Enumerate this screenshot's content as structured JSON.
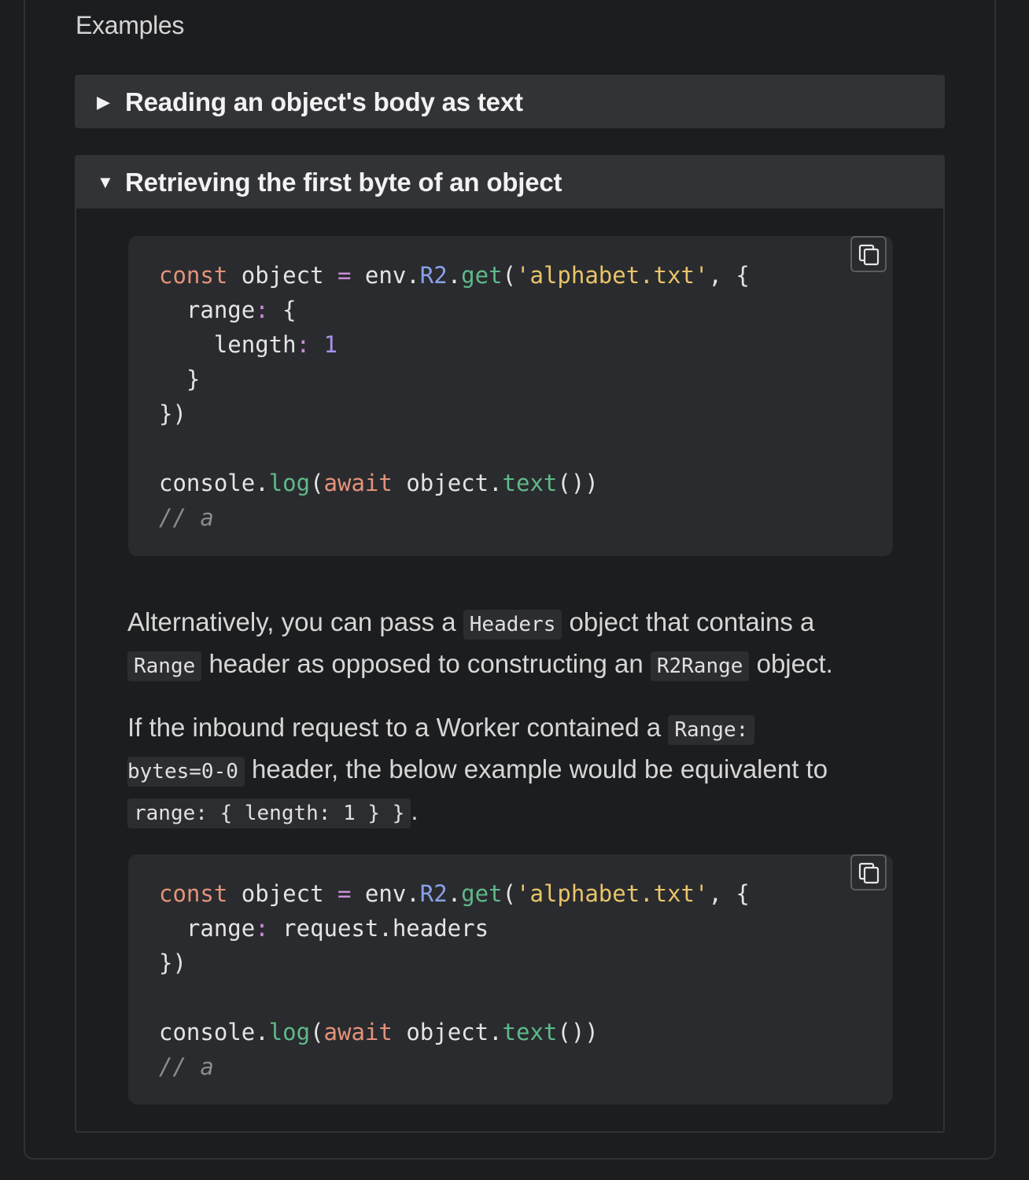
{
  "section": {
    "title": "Examples"
  },
  "example1": {
    "arrow": "▶",
    "title": "Reading an object's body as text"
  },
  "example2": {
    "arrow": "▼",
    "title": "Retrieving the first byte of an object"
  },
  "code1": {
    "tokens": {
      "const": "const",
      "object_decl": " object ",
      "eq": "=",
      "env": " env.",
      "r2": "R2",
      "dot": ".",
      "get": "get",
      "paren_open": "(",
      "filename": "'alphabet.txt'",
      "comma_brace": ", {",
      "range_key": "  range",
      "colon": ":",
      "brace_open": " {",
      "length_key": "    length",
      "length_val": "1",
      "brace_close": "  }",
      "end_call": "})",
      "console": "console.",
      "log": "log",
      "await": "await",
      "object_ref": " object.",
      "text": "text",
      "parens_end": "())",
      "comment": "// a"
    }
  },
  "para1": {
    "t1": "Alternatively, you can pass a ",
    "code_headers": "Headers",
    "t2": " object that contains a ",
    "code_range": "Range",
    "t3": " header as opposed to constructing an ",
    "code_r2range": "R2Range",
    "t4": " object."
  },
  "para2": {
    "t1": "If the inbound request to a Worker contained a ",
    "code_range_hdr_a": "Range:",
    "code_range_hdr_b": "bytes=0-0",
    "t2": " header, the below example would be equivalent to",
    "code_equiv": "range: { length: 1 } }",
    "t3": "."
  },
  "code2": {
    "tokens": {
      "range_key": "  range",
      "colon": ":",
      "headers_val": " request.headers"
    }
  },
  "icons": {
    "copy": "copy-icon",
    "collapsed": "triangle-right-icon",
    "expanded": "triangle-down-icon"
  }
}
